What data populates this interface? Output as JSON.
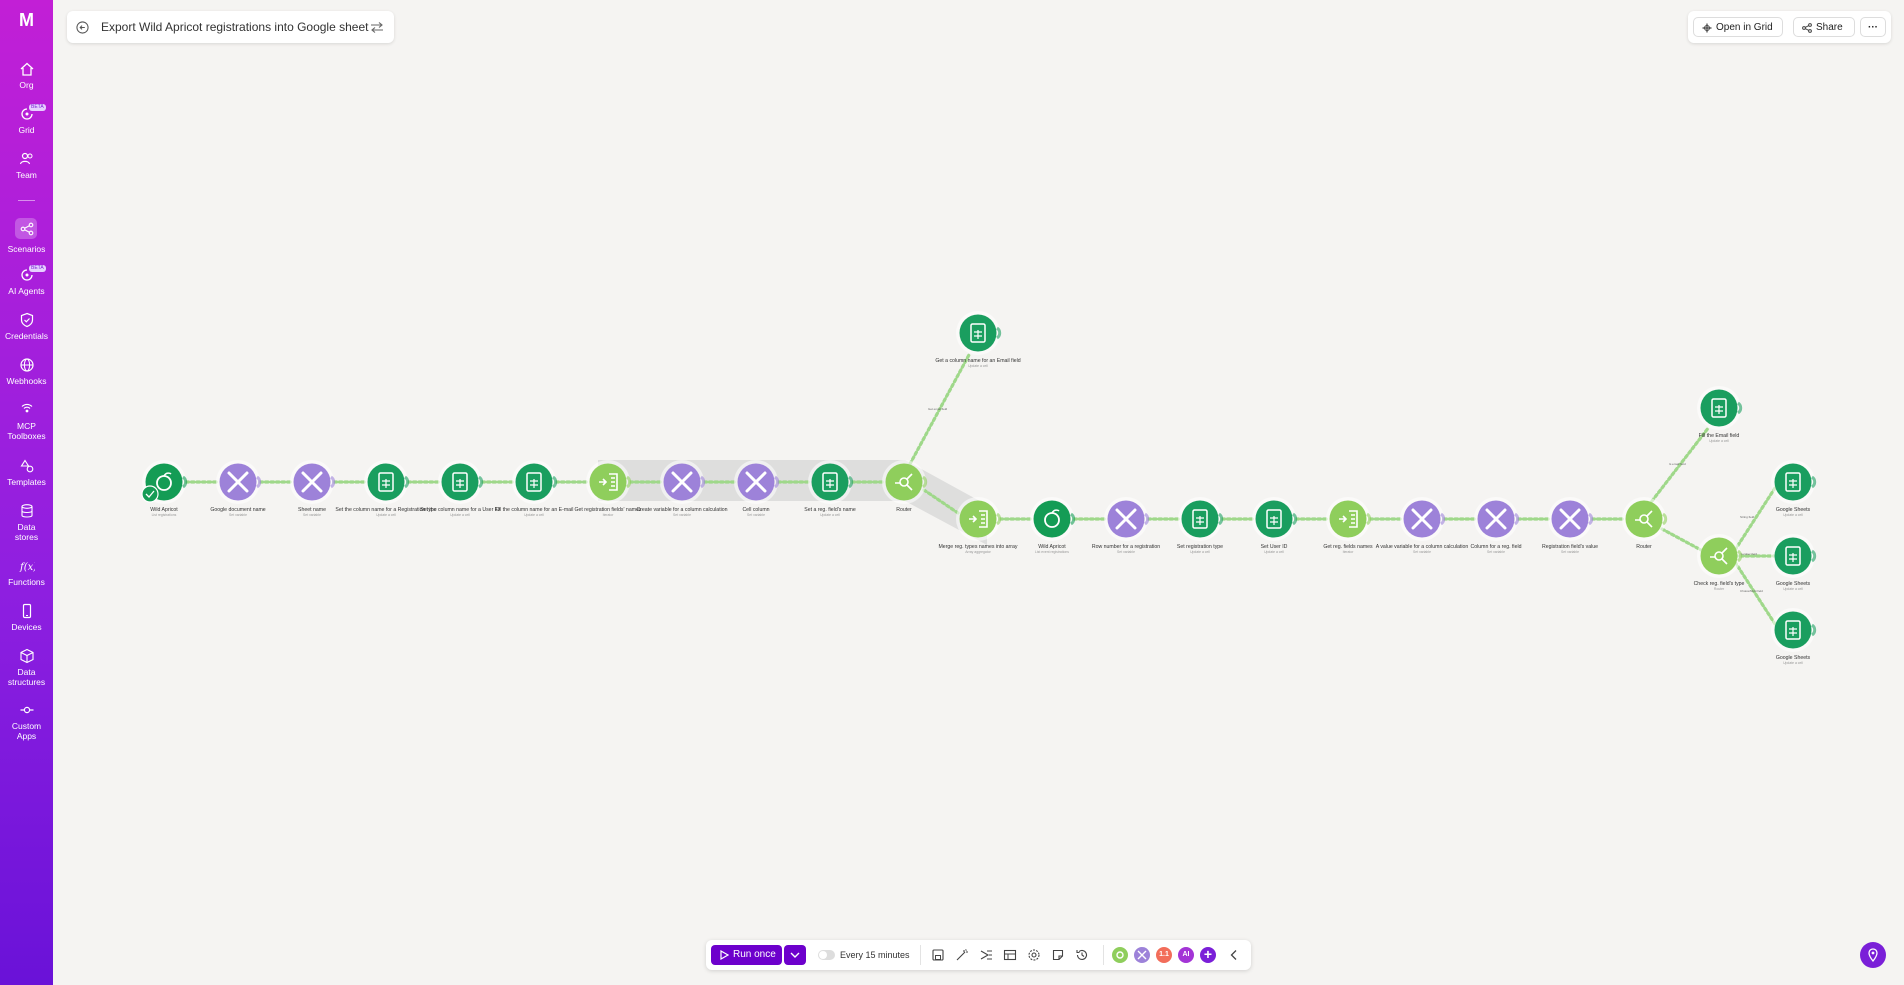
{
  "app": {
    "logo": "M",
    "title": "Export Wild Apricot registrations into Google sheet"
  },
  "sidebar": {
    "items": [
      {
        "label": "Org"
      },
      {
        "label": "Grid",
        "badge": "BETA"
      },
      {
        "label": "Team"
      },
      {
        "label": "Scenarios"
      },
      {
        "label": "AI Agents",
        "badge": "BETA"
      },
      {
        "label": "Credentials"
      },
      {
        "label": "Webhooks"
      },
      {
        "label": "MCP Toolboxes"
      },
      {
        "label": "Templates"
      },
      {
        "label": "Data stores"
      },
      {
        "label": "Functions"
      },
      {
        "label": "Devices"
      },
      {
        "label": "Data structures"
      },
      {
        "label": "Custom Apps"
      }
    ]
  },
  "header": {
    "open_in_grid": "Open in Grid",
    "share": "Share",
    "more": "···"
  },
  "toolbar": {
    "run_once": "Run once",
    "schedule": "Every 15 minutes",
    "ai_pill": "AI",
    "counter_pill": "1.1"
  },
  "colors": {
    "accent": "#6d00cc",
    "sheets": "#1a9e5f",
    "tools": "#9d82d9",
    "flow": "#8fce5c",
    "apricot": "#149c55"
  },
  "scenario": {
    "main": [
      {
        "label": "Wild Apricot",
        "sub": "List registrations",
        "kind": "apricot"
      },
      {
        "label": "Google document name",
        "sub": "Set variable",
        "kind": "tools"
      },
      {
        "label": "Sheet name",
        "sub": "Set variable",
        "kind": "tools"
      },
      {
        "label": "Set the column name for a Registration type",
        "sub": "Update a cell",
        "kind": "sheets"
      },
      {
        "label": "Set the column name for a User ID",
        "sub": "Update a cell",
        "kind": "sheets"
      },
      {
        "label": "Fill the column name for an E-mail",
        "sub": "Update a cell",
        "kind": "sheets"
      },
      {
        "label": "Get registration fields' names",
        "sub": "Iterator",
        "kind": "flow"
      },
      {
        "label": "Create variable for a column calculation",
        "sub": "Set variable",
        "kind": "tools"
      },
      {
        "label": "Cell column",
        "sub": "Set variable",
        "kind": "tools"
      },
      {
        "label": "Set a reg. field's name",
        "sub": "Update a cell",
        "kind": "sheets"
      },
      {
        "label": "Router",
        "sub": "",
        "kind": "router"
      }
    ],
    "top_branch": {
      "label": "Get a column name for an Email field",
      "sub": "Update a cell",
      "filter": "Get email field"
    },
    "second": [
      {
        "label": "Merge reg. types names into array",
        "sub": "Array aggregator",
        "kind": "flow"
      },
      {
        "label": "Wild Apricot",
        "sub": "List event registrations",
        "kind": "apricot"
      },
      {
        "label": "Row number for a registration",
        "sub": "Set variable",
        "kind": "tools"
      },
      {
        "label": "Set registration type",
        "sub": "Update a cell",
        "kind": "sheets"
      },
      {
        "label": "Set User ID",
        "sub": "Update a cell",
        "kind": "sheets"
      },
      {
        "label": "Get reg. fields names",
        "sub": "Iterator",
        "kind": "flow"
      },
      {
        "label": "A value variable for a column calculation",
        "sub": "Set variable",
        "kind": "tools"
      },
      {
        "label": "Column for a reg. field",
        "sub": "Set variable",
        "kind": "tools"
      },
      {
        "label": "Registration field's value",
        "sub": "Set variable",
        "kind": "tools"
      },
      {
        "label": "Router",
        "sub": "",
        "kind": "router"
      }
    ],
    "branches": {
      "email": {
        "label": "Fill the Email field",
        "sub": "Update a cell",
        "filter": "Is email field"
      },
      "check": {
        "label": "Check reg. field's type",
        "sub": "Router"
      },
      "sheets": [
        {
          "label": "Google Sheets",
          "sub": "Update a cell",
          "filter": "String field"
        },
        {
          "label": "Google Sheets",
          "sub": "Update a cell",
          "filter": "Number field"
        },
        {
          "label": "Google Sheets",
          "sub": "Update a cell",
          "filter": "Choice/Multi field"
        }
      ]
    }
  }
}
